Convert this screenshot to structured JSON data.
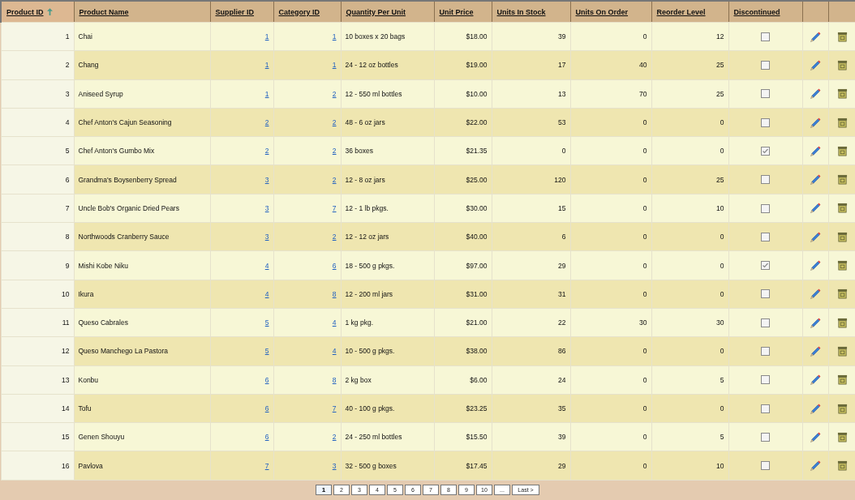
{
  "table": {
    "columns": [
      {
        "label": "Product ID",
        "sorted": true
      },
      {
        "label": "Product Name",
        "sorted": false
      },
      {
        "label": "Supplier ID",
        "sorted": false
      },
      {
        "label": "Category ID",
        "sorted": false
      },
      {
        "label": "Quantity Per Unit",
        "sorted": false
      },
      {
        "label": "Unit Price",
        "sorted": false
      },
      {
        "label": "Units In Stock",
        "sorted": false
      },
      {
        "label": "Units On Order",
        "sorted": false
      },
      {
        "label": "Reorder Level",
        "sorted": false
      },
      {
        "label": "Discontinued",
        "sorted": false
      }
    ],
    "rows": [
      {
        "id": "1",
        "name": "Chai",
        "supplier": "1",
        "category": "1",
        "quantity": "10 boxes x 20 bags",
        "price": "$18.00",
        "stock": "39",
        "on_order": "0",
        "reorder": "12",
        "discontinued": false
      },
      {
        "id": "2",
        "name": "Chang",
        "supplier": "1",
        "category": "1",
        "quantity": "24 - 12 oz bottles",
        "price": "$19.00",
        "stock": "17",
        "on_order": "40",
        "reorder": "25",
        "discontinued": false
      },
      {
        "id": "3",
        "name": "Aniseed Syrup",
        "supplier": "1",
        "category": "2",
        "quantity": "12 - 550 ml bottles",
        "price": "$10.00",
        "stock": "13",
        "on_order": "70",
        "reorder": "25",
        "discontinued": false
      },
      {
        "id": "4",
        "name": "Chef Anton's Cajun Seasoning",
        "supplier": "2",
        "category": "2",
        "quantity": "48 - 6 oz jars",
        "price": "$22.00",
        "stock": "53",
        "on_order": "0",
        "reorder": "0",
        "discontinued": false
      },
      {
        "id": "5",
        "name": "Chef Anton's Gumbo Mix",
        "supplier": "2",
        "category": "2",
        "quantity": "36 boxes",
        "price": "$21.35",
        "stock": "0",
        "on_order": "0",
        "reorder": "0",
        "discontinued": true
      },
      {
        "id": "6",
        "name": "Grandma's Boysenberry Spread",
        "supplier": "3",
        "category": "2",
        "quantity": "12 - 8 oz jars",
        "price": "$25.00",
        "stock": "120",
        "on_order": "0",
        "reorder": "25",
        "discontinued": false
      },
      {
        "id": "7",
        "name": "Uncle Bob's Organic Dried Pears",
        "supplier": "3",
        "category": "7",
        "quantity": "12 - 1 lb pkgs.",
        "price": "$30.00",
        "stock": "15",
        "on_order": "0",
        "reorder": "10",
        "discontinued": false
      },
      {
        "id": "8",
        "name": "Northwoods Cranberry Sauce",
        "supplier": "3",
        "category": "2",
        "quantity": "12 - 12 oz jars",
        "price": "$40.00",
        "stock": "6",
        "on_order": "0",
        "reorder": "0",
        "discontinued": false
      },
      {
        "id": "9",
        "name": "Mishi Kobe Niku",
        "supplier": "4",
        "category": "6",
        "quantity": "18 - 500 g pkgs.",
        "price": "$97.00",
        "stock": "29",
        "on_order": "0",
        "reorder": "0",
        "discontinued": true
      },
      {
        "id": "10",
        "name": "Ikura",
        "supplier": "4",
        "category": "8",
        "quantity": "12 - 200 ml jars",
        "price": "$31.00",
        "stock": "31",
        "on_order": "0",
        "reorder": "0",
        "discontinued": false
      },
      {
        "id": "11",
        "name": "Queso Cabrales",
        "supplier": "5",
        "category": "4",
        "quantity": "1 kg pkg.",
        "price": "$21.00",
        "stock": "22",
        "on_order": "30",
        "reorder": "30",
        "discontinued": false
      },
      {
        "id": "12",
        "name": "Queso Manchego La Pastora",
        "supplier": "5",
        "category": "4",
        "quantity": "10 - 500 g pkgs.",
        "price": "$38.00",
        "stock": "86",
        "on_order": "0",
        "reorder": "0",
        "discontinued": false
      },
      {
        "id": "13",
        "name": "Konbu",
        "supplier": "6",
        "category": "8",
        "quantity": "2 kg box",
        "price": "$6.00",
        "stock": "24",
        "on_order": "0",
        "reorder": "5",
        "discontinued": false
      },
      {
        "id": "14",
        "name": "Tofu",
        "supplier": "6",
        "category": "7",
        "quantity": "40 - 100 g pkgs.",
        "price": "$23.25",
        "stock": "35",
        "on_order": "0",
        "reorder": "0",
        "discontinued": false
      },
      {
        "id": "15",
        "name": "Genen Shouyu",
        "supplier": "6",
        "category": "2",
        "quantity": "24 - 250 ml bottles",
        "price": "$15.50",
        "stock": "39",
        "on_order": "0",
        "reorder": "5",
        "discontinued": false
      },
      {
        "id": "16",
        "name": "Pavlova",
        "supplier": "7",
        "category": "3",
        "quantity": "32 - 500 g boxes",
        "price": "$17.45",
        "stock": "29",
        "on_order": "0",
        "reorder": "10",
        "discontinued": false
      }
    ]
  },
  "pager": [
    {
      "label": "1",
      "selected": true
    },
    {
      "label": "2",
      "selected": false
    },
    {
      "label": "3",
      "selected": false
    },
    {
      "label": "4",
      "selected": false
    },
    {
      "label": "5",
      "selected": false
    },
    {
      "label": "6",
      "selected": false
    },
    {
      "label": "7",
      "selected": false
    },
    {
      "label": "8",
      "selected": false
    },
    {
      "label": "9",
      "selected": false
    },
    {
      "label": "10",
      "selected": false
    },
    {
      "label": "...",
      "selected": false
    },
    {
      "label": "Last >",
      "selected": false
    }
  ]
}
